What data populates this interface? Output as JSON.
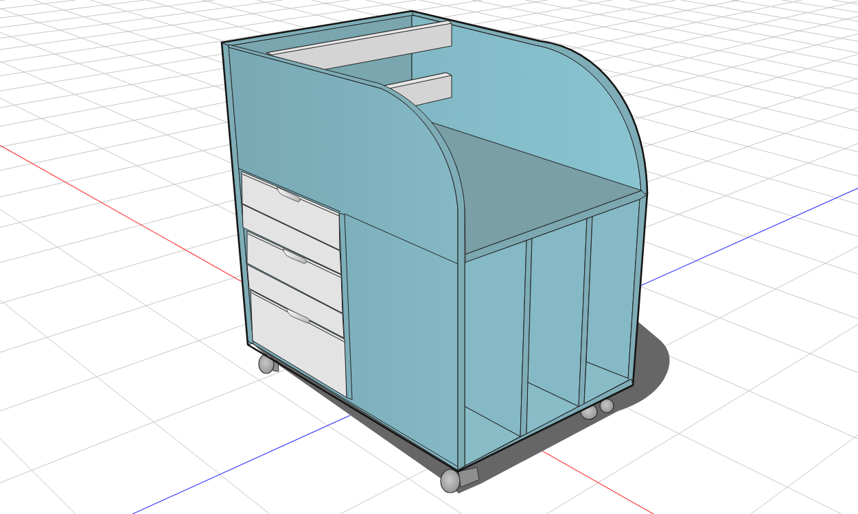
{
  "viewport": {
    "axes": [
      {
        "color": "#ff3b3b"
      },
      {
        "color": "#3b3bff"
      }
    ]
  }
}
